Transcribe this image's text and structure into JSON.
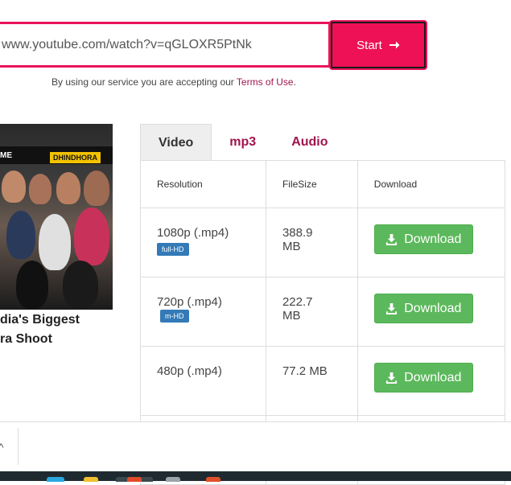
{
  "search": {
    "url_value": "www.youtube.com/watch?v=qGLOXR5PtNk",
    "start_label": "Start",
    "arrow_icon": "arrow-right-icon"
  },
  "terms": {
    "prefix": "By using our service you are accepting our ",
    "link_text": "Terms of Use",
    "suffix": "."
  },
  "video": {
    "thumb_tag": "DHINDHORA",
    "thumb_me": "ME",
    "title_line1": "dia's Biggest",
    "title_line2": "ra Shoot"
  },
  "tabs": [
    {
      "label": "Video",
      "active": true
    },
    {
      "label": "mp3",
      "active": false
    },
    {
      "label": "Audio",
      "active": false
    }
  ],
  "table": {
    "headers": [
      "Resolution",
      "FileSize",
      "Download"
    ],
    "rows": [
      {
        "resolution": "1080p (.mp4)",
        "badge": "full-HD",
        "size_line1": "388.9",
        "size_line2": "MB",
        "download": "Download"
      },
      {
        "resolution": "720p (.mp4)",
        "badge": "m-HD",
        "size_line1": "222.7",
        "size_line2": "MB",
        "download": "Download"
      },
      {
        "resolution": "480p (.mp4)",
        "badge": "",
        "size_line1": "77.2 MB",
        "size_line2": "",
        "download": "Download"
      }
    ]
  },
  "colors": {
    "accent": "#ee1155",
    "link": "#a0154d",
    "download": "#5cb85c",
    "badge": "#337ab7"
  },
  "bottom": {
    "chevron": "^"
  }
}
